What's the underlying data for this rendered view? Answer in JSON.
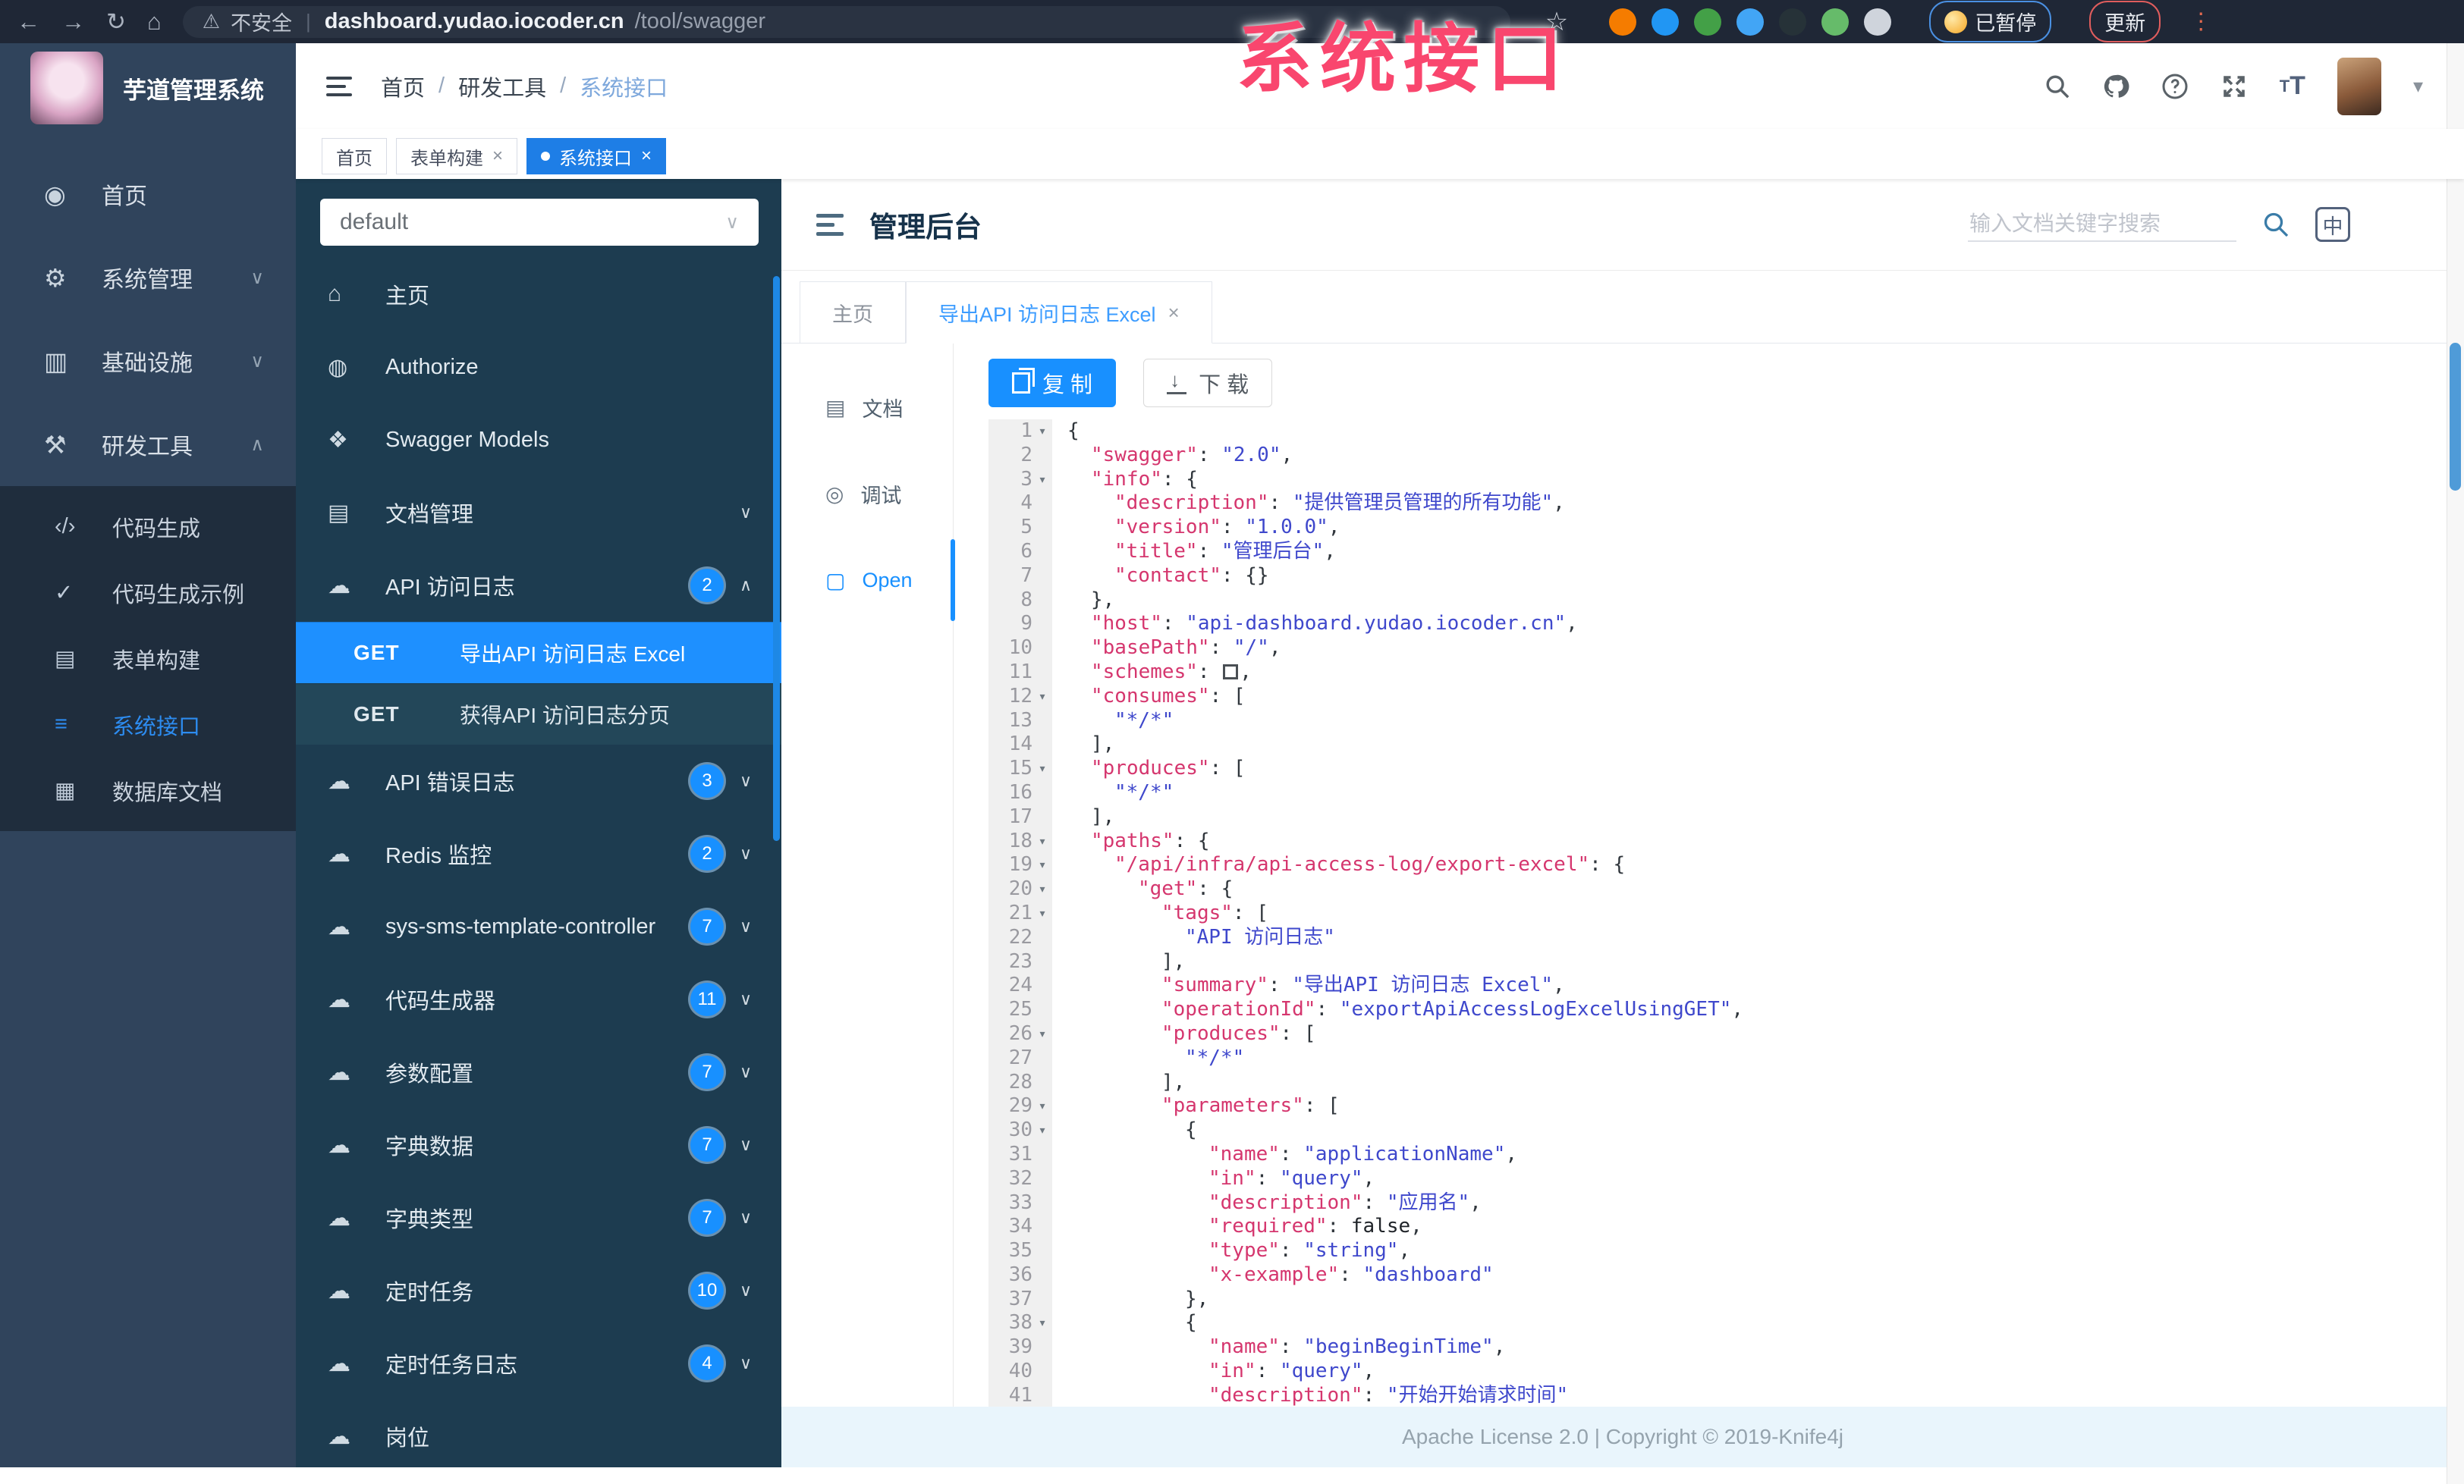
{
  "overlay": {
    "text": "系统接口"
  },
  "browser": {
    "security_label": "不安全",
    "url_host": "dashboard.yudao.iocoder.cn",
    "url_path": "/tool/swagger",
    "paused_label": "已暂停",
    "update_label": "更新",
    "extensions": [
      {
        "name": "extension-orange",
        "color": "#f57c00"
      },
      {
        "name": "extension-blue-drop",
        "color": "#2196f3"
      },
      {
        "name": "extension-green-circle",
        "color": "#43a047"
      },
      {
        "name": "extension-blue-grid",
        "color": "#42a5f5"
      },
      {
        "name": "extension-dark-gm",
        "color": "#263238"
      },
      {
        "name": "extension-green-leaf",
        "color": "#66bb6a"
      },
      {
        "name": "extension-light-paw",
        "color": "#cfd4dc"
      }
    ]
  },
  "sidebar1": {
    "title": "芋道管理系统",
    "items": [
      {
        "label": "首页",
        "icon": "dashboard-icon",
        "glyph": "◉",
        "chevron": ""
      },
      {
        "label": "系统管理",
        "icon": "gear-icon",
        "glyph": "⚙",
        "chevron": "∨"
      },
      {
        "label": "基础设施",
        "icon": "infrastructure-icon",
        "glyph": "▥",
        "chevron": "∨"
      },
      {
        "label": "研发工具",
        "icon": "dev-tools-icon",
        "glyph": "⚒",
        "chevron": "∧"
      }
    ],
    "subitems": [
      {
        "label": "代码生成",
        "icon": "code-icon",
        "glyph": "‹/›",
        "active": false
      },
      {
        "label": "代码生成示例",
        "icon": "shield-check-icon",
        "glyph": "✓",
        "active": false
      },
      {
        "label": "表单构建",
        "icon": "form-icon",
        "glyph": "▤",
        "active": false
      },
      {
        "label": "系统接口",
        "icon": "api-list-icon",
        "glyph": "≡",
        "active": true
      },
      {
        "label": "数据库文档",
        "icon": "database-icon",
        "glyph": "▦",
        "active": false
      }
    ]
  },
  "topbar": {
    "breadcrumb": [
      "首页",
      "研发工具",
      "系统接口"
    ]
  },
  "tags": [
    {
      "label": "首页",
      "closable": false,
      "active": false
    },
    {
      "label": "表单构建",
      "closable": true,
      "active": false
    },
    {
      "label": "系统接口",
      "closable": true,
      "active": true
    }
  ],
  "sidebar2": {
    "select_value": "default",
    "items_top": [
      {
        "label": "主页",
        "icon": "home-icon",
        "glyph": "⌂",
        "badge": "",
        "chevron": ""
      },
      {
        "label": "Authorize",
        "icon": "lock-icon",
        "glyph": "◍",
        "badge": "",
        "chevron": ""
      },
      {
        "label": "Swagger Models",
        "icon": "models-icon",
        "glyph": "❖",
        "badge": "",
        "chevron": ""
      },
      {
        "label": "文档管理",
        "icon": "doc-manage-icon",
        "glyph": "▤",
        "badge": "",
        "chevron": "∨"
      },
      {
        "label": "API 访问日志",
        "icon": "cloud-api-icon",
        "glyph": "☁",
        "badge": "2",
        "chevron": "∧"
      }
    ],
    "api_children": [
      {
        "method": "GET",
        "label": "导出API 访问日志 Excel",
        "active": true
      },
      {
        "method": "GET",
        "label": "获得API 访问日志分页",
        "active": false
      }
    ],
    "items_bottom": [
      {
        "label": "API 错误日志",
        "icon": "cloud-api-icon",
        "glyph": "☁",
        "badge": "3",
        "chevron": "∨"
      },
      {
        "label": "Redis 监控",
        "icon": "cloud-api-icon",
        "glyph": "☁",
        "badge": "2",
        "chevron": "∨"
      },
      {
        "label": "sys-sms-template-controller",
        "icon": "cloud-api-icon",
        "glyph": "☁",
        "badge": "7",
        "chevron": "∨"
      },
      {
        "label": "代码生成器",
        "icon": "cloud-api-icon",
        "glyph": "☁",
        "badge": "11",
        "chevron": "∨"
      },
      {
        "label": "参数配置",
        "icon": "cloud-api-icon",
        "glyph": "☁",
        "badge": "7",
        "chevron": "∨"
      },
      {
        "label": "字典数据",
        "icon": "cloud-api-icon",
        "glyph": "☁",
        "badge": "7",
        "chevron": "∨"
      },
      {
        "label": "字典类型",
        "icon": "cloud-api-icon",
        "glyph": "☁",
        "badge": "7",
        "chevron": "∨"
      },
      {
        "label": "定时任务",
        "icon": "cloud-api-icon",
        "glyph": "☁",
        "badge": "10",
        "chevron": "∨"
      },
      {
        "label": "定时任务日志",
        "icon": "cloud-api-icon",
        "glyph": "☁",
        "badge": "4",
        "chevron": "∨"
      },
      {
        "label": "岗位",
        "icon": "cloud-api-icon",
        "glyph": "☁",
        "badge": "",
        "chevron": ""
      }
    ]
  },
  "doc": {
    "title": "管理后台",
    "search_placeholder": "输入文档关键字搜索",
    "lang_icon_label": "中",
    "tabs": [
      {
        "label": "主页",
        "closable": false,
        "active": false
      },
      {
        "label": "导出API 访问日志 Excel",
        "closable": true,
        "active": true
      }
    ],
    "side_items": [
      {
        "label": "文档",
        "icon": "document-icon",
        "glyph": "▤",
        "active": false
      },
      {
        "label": "调试",
        "icon": "debug-icon",
        "glyph": "◎",
        "active": false
      },
      {
        "label": "Open",
        "icon": "file-icon",
        "glyph": "▢",
        "active": true
      }
    ],
    "copy_label": "复 制",
    "download_label": "下 载",
    "footer": "Apache License 2.0 | Copyright © 2019-Knife4j"
  },
  "code": {
    "lines": [
      {
        "n": 1,
        "i": 0,
        "f": true,
        "t": [
          [
            "p",
            "{"
          ]
        ]
      },
      {
        "n": 2,
        "i": 1,
        "f": false,
        "t": [
          [
            "k",
            "swagger"
          ],
          [
            "p",
            ": "
          ],
          [
            "s",
            "2.0"
          ],
          [
            "p",
            ","
          ]
        ]
      },
      {
        "n": 3,
        "i": 1,
        "f": true,
        "t": [
          [
            "k",
            "info"
          ],
          [
            "p",
            ": {"
          ]
        ]
      },
      {
        "n": 4,
        "i": 2,
        "f": false,
        "t": [
          [
            "k",
            "description"
          ],
          [
            "p",
            ": "
          ],
          [
            "s",
            "提供管理员管理的所有功能"
          ],
          [
            "p",
            ","
          ]
        ]
      },
      {
        "n": 5,
        "i": 2,
        "f": false,
        "t": [
          [
            "k",
            "version"
          ],
          [
            "p",
            ": "
          ],
          [
            "s",
            "1.0.0"
          ],
          [
            "p",
            ","
          ]
        ]
      },
      {
        "n": 6,
        "i": 2,
        "f": false,
        "t": [
          [
            "k",
            "title"
          ],
          [
            "p",
            ": "
          ],
          [
            "s",
            "管理后台"
          ],
          [
            "p",
            ","
          ]
        ]
      },
      {
        "n": 7,
        "i": 2,
        "f": false,
        "t": [
          [
            "k",
            "contact"
          ],
          [
            "p",
            ": {}"
          ]
        ]
      },
      {
        "n": 8,
        "i": 1,
        "f": false,
        "t": [
          [
            "p",
            "},"
          ]
        ]
      },
      {
        "n": 9,
        "i": 1,
        "f": false,
        "t": [
          [
            "k",
            "host"
          ],
          [
            "p",
            ": "
          ],
          [
            "s",
            "api-dashboard.yudao.iocoder.cn"
          ],
          [
            "p",
            ","
          ]
        ]
      },
      {
        "n": 10,
        "i": 1,
        "f": false,
        "t": [
          [
            "k",
            "basePath"
          ],
          [
            "p",
            ": "
          ],
          [
            "s",
            "/"
          ],
          [
            "p",
            ","
          ]
        ]
      },
      {
        "n": 11,
        "i": 1,
        "f": false,
        "t": [
          [
            "k",
            "schemes"
          ],
          [
            "p",
            ": "
          ],
          [
            "x",
            ""
          ],
          [
            "p",
            ","
          ]
        ]
      },
      {
        "n": 12,
        "i": 1,
        "f": true,
        "t": [
          [
            "k",
            "consumes"
          ],
          [
            "p",
            ": ["
          ]
        ]
      },
      {
        "n": 13,
        "i": 2,
        "f": false,
        "t": [
          [
            "s",
            "*/*"
          ]
        ]
      },
      {
        "n": 14,
        "i": 1,
        "f": false,
        "t": [
          [
            "p",
            "],"
          ]
        ]
      },
      {
        "n": 15,
        "i": 1,
        "f": true,
        "t": [
          [
            "k",
            "produces"
          ],
          [
            "p",
            ": ["
          ]
        ]
      },
      {
        "n": 16,
        "i": 2,
        "f": false,
        "t": [
          [
            "s",
            "*/*"
          ]
        ]
      },
      {
        "n": 17,
        "i": 1,
        "f": false,
        "t": [
          [
            "p",
            "],"
          ]
        ]
      },
      {
        "n": 18,
        "i": 1,
        "f": true,
        "t": [
          [
            "k",
            "paths"
          ],
          [
            "p",
            ": {"
          ]
        ]
      },
      {
        "n": 19,
        "i": 2,
        "f": true,
        "t": [
          [
            "k",
            "/api/infra/api-access-log/export-excel"
          ],
          [
            "p",
            ": {"
          ]
        ]
      },
      {
        "n": 20,
        "i": 3,
        "f": true,
        "t": [
          [
            "k",
            "get"
          ],
          [
            "p",
            ": {"
          ]
        ]
      },
      {
        "n": 21,
        "i": 4,
        "f": true,
        "t": [
          [
            "k",
            "tags"
          ],
          [
            "p",
            ": ["
          ]
        ]
      },
      {
        "n": 22,
        "i": 5,
        "f": false,
        "t": [
          [
            "s",
            "API 访问日志"
          ]
        ]
      },
      {
        "n": 23,
        "i": 4,
        "f": false,
        "t": [
          [
            "p",
            "],"
          ]
        ]
      },
      {
        "n": 24,
        "i": 4,
        "f": false,
        "t": [
          [
            "k",
            "summary"
          ],
          [
            "p",
            ": "
          ],
          [
            "s",
            "导出API 访问日志 Excel"
          ],
          [
            "p",
            ","
          ]
        ]
      },
      {
        "n": 25,
        "i": 4,
        "f": false,
        "t": [
          [
            "k",
            "operationId"
          ],
          [
            "p",
            ": "
          ],
          [
            "s",
            "exportApiAccessLogExcelUsingGET"
          ],
          [
            "p",
            ","
          ]
        ]
      },
      {
        "n": 26,
        "i": 4,
        "f": true,
        "t": [
          [
            "k",
            "produces"
          ],
          [
            "p",
            ": ["
          ]
        ]
      },
      {
        "n": 27,
        "i": 5,
        "f": false,
        "t": [
          [
            "s",
            "*/*"
          ]
        ]
      },
      {
        "n": 28,
        "i": 4,
        "f": false,
        "t": [
          [
            "p",
            "],"
          ]
        ]
      },
      {
        "n": 29,
        "i": 4,
        "f": true,
        "t": [
          [
            "k",
            "parameters"
          ],
          [
            "p",
            ": ["
          ]
        ]
      },
      {
        "n": 30,
        "i": 5,
        "f": true,
        "t": [
          [
            "p",
            "{"
          ]
        ]
      },
      {
        "n": 31,
        "i": 6,
        "f": false,
        "t": [
          [
            "k",
            "name"
          ],
          [
            "p",
            ": "
          ],
          [
            "s",
            "applicationName"
          ],
          [
            "p",
            ","
          ]
        ]
      },
      {
        "n": 32,
        "i": 6,
        "f": false,
        "t": [
          [
            "k",
            "in"
          ],
          [
            "p",
            ": "
          ],
          [
            "s",
            "query"
          ],
          [
            "p",
            ","
          ]
        ]
      },
      {
        "n": 33,
        "i": 6,
        "f": false,
        "t": [
          [
            "k",
            "description"
          ],
          [
            "p",
            ": "
          ],
          [
            "s",
            "应用名"
          ],
          [
            "p",
            ","
          ]
        ]
      },
      {
        "n": 34,
        "i": 6,
        "f": false,
        "t": [
          [
            "k",
            "required"
          ],
          [
            "p",
            ": "
          ],
          [
            "b",
            "false"
          ],
          [
            "p",
            ","
          ]
        ]
      },
      {
        "n": 35,
        "i": 6,
        "f": false,
        "t": [
          [
            "k",
            "type"
          ],
          [
            "p",
            ": "
          ],
          [
            "s",
            "string"
          ],
          [
            "p",
            ","
          ]
        ]
      },
      {
        "n": 36,
        "i": 6,
        "f": false,
        "t": [
          [
            "k",
            "x-example"
          ],
          [
            "p",
            ": "
          ],
          [
            "s",
            "dashboard"
          ]
        ]
      },
      {
        "n": 37,
        "i": 5,
        "f": false,
        "t": [
          [
            "p",
            "},"
          ]
        ]
      },
      {
        "n": 38,
        "i": 5,
        "f": true,
        "t": [
          [
            "p",
            "{"
          ]
        ]
      },
      {
        "n": 39,
        "i": 6,
        "f": false,
        "t": [
          [
            "k",
            "name"
          ],
          [
            "p",
            ": "
          ],
          [
            "s",
            "beginBeginTime"
          ],
          [
            "p",
            ","
          ]
        ]
      },
      {
        "n": 40,
        "i": 6,
        "f": false,
        "t": [
          [
            "k",
            "in"
          ],
          [
            "p",
            ": "
          ],
          [
            "s",
            "query"
          ],
          [
            "p",
            ","
          ]
        ]
      },
      {
        "n": 41,
        "i": 6,
        "f": false,
        "t": [
          [
            "k",
            "description"
          ],
          [
            "p",
            ": "
          ],
          [
            "s",
            "开始开始请求时间"
          ]
        ]
      }
    ]
  }
}
